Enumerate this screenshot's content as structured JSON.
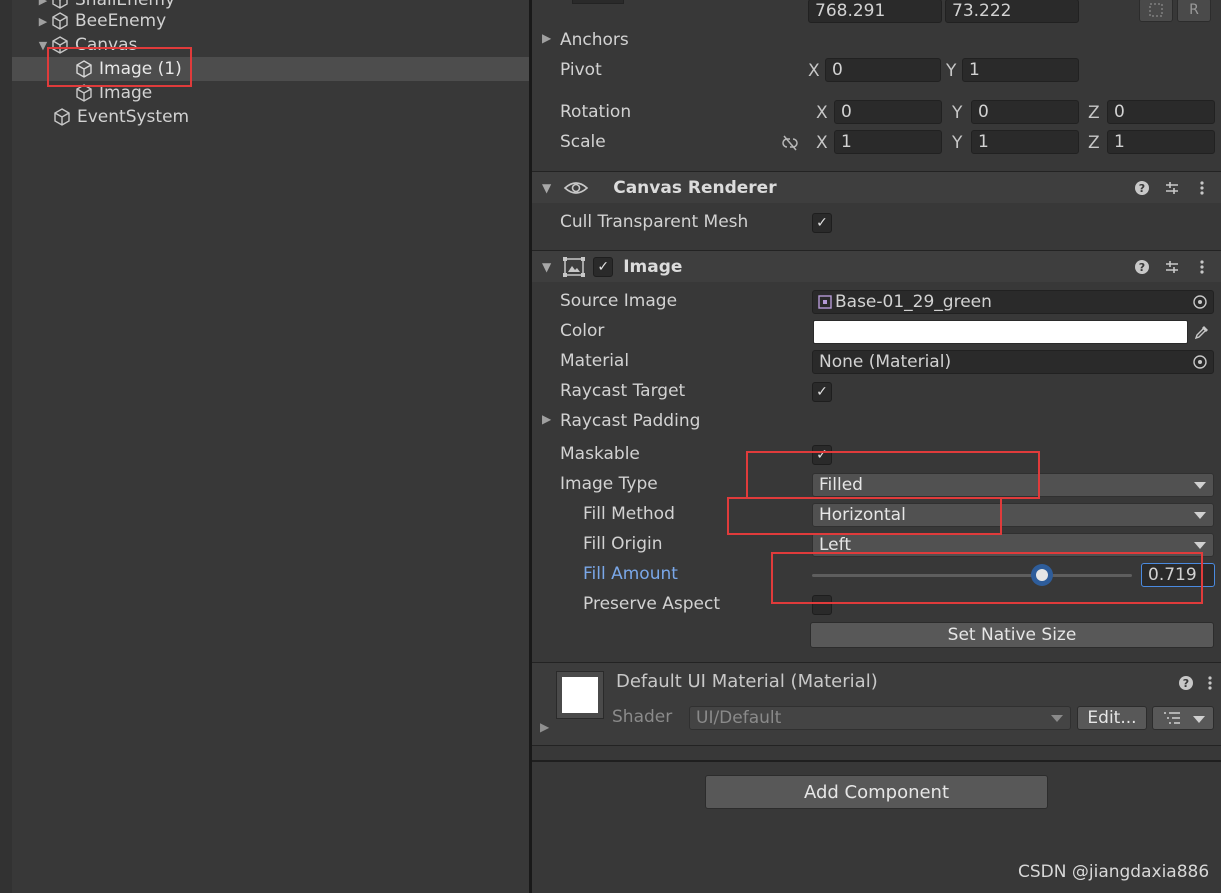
{
  "hierarchy": {
    "items": [
      {
        "label": "SnailEnemy"
      },
      {
        "label": "BeeEnemy"
      },
      {
        "label": "Canvas"
      },
      {
        "label": "Image (1)"
      },
      {
        "label": "Image"
      },
      {
        "label": "EventSystem"
      }
    ]
  },
  "rect_transform": {
    "width": "768.291",
    "height": "73.222",
    "anchors_label": "Anchors",
    "pivot_label": "Pivot",
    "pivot_x": "0",
    "pivot_y": "1",
    "rotation_label": "Rotation",
    "rotation_x": "0",
    "rotation_y": "0",
    "rotation_z": "0",
    "scale_label": "Scale",
    "scale_x": "1",
    "scale_y": "1",
    "scale_z": "1",
    "axis_x": "X",
    "axis_y": "Y",
    "axis_z": "Z"
  },
  "canvas_renderer": {
    "title": "Canvas Renderer",
    "cull_label": "Cull Transparent Mesh"
  },
  "image": {
    "title": "Image",
    "source_image_label": "Source Image",
    "source_image_value": "Base-01_29_green",
    "color_label": "Color",
    "color_value": "#ffffff",
    "material_label": "Material",
    "material_value": "None (Material)",
    "raycast_target_label": "Raycast Target",
    "raycast_padding_label": "Raycast Padding",
    "maskable_label": "Maskable",
    "image_type_label": "Image Type",
    "image_type_value": "Filled",
    "fill_method_label": "Fill Method",
    "fill_method_value": "Horizontal",
    "fill_origin_label": "Fill Origin",
    "fill_origin_value": "Left",
    "fill_amount_label": "Fill Amount",
    "fill_amount_value": "0.719",
    "fill_amount_fraction": 0.719,
    "preserve_aspect_label": "Preserve Aspect",
    "set_native_size": "Set Native Size"
  },
  "material": {
    "title": "Default UI Material (Material)",
    "shader_label": "Shader",
    "shader_value": "UI/Default",
    "edit_label": "Edit..."
  },
  "add_component": "Add Component",
  "watermark": "CSDN @jiangdaxia886",
  "colors": {
    "accent": "#7aa7e8",
    "highlight_box": "#e03b3b",
    "slider_thumb": "#2e5d9b"
  }
}
